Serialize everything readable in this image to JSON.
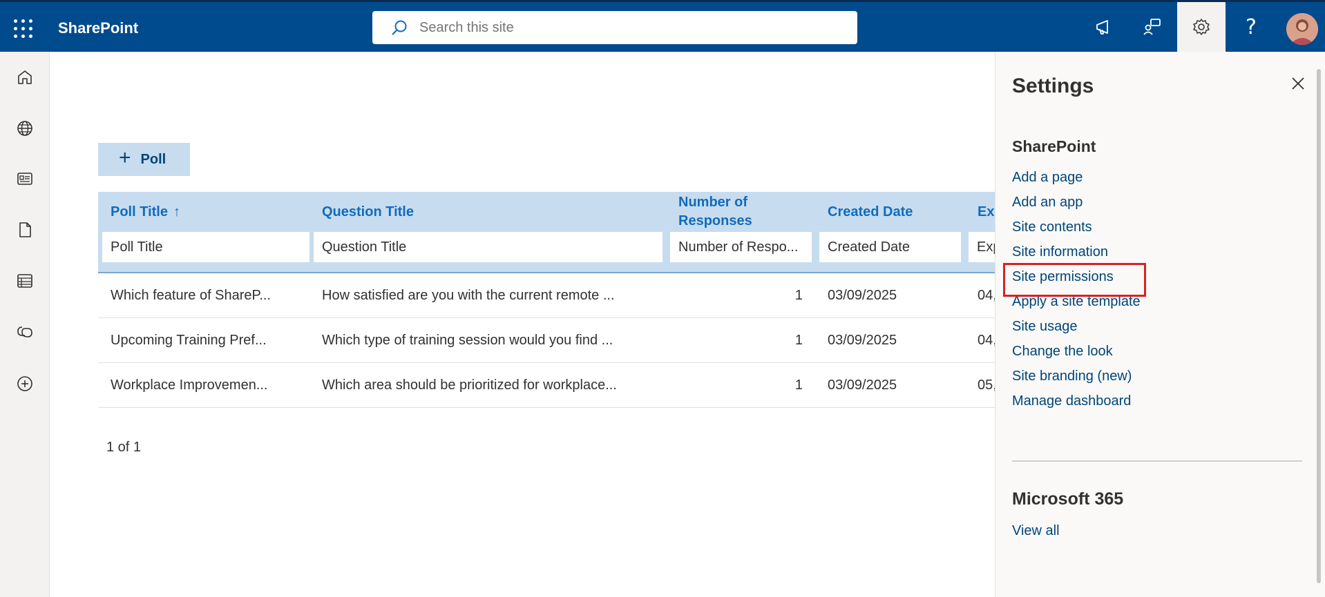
{
  "app": {
    "brand": "SharePoint"
  },
  "search": {
    "placeholder": "Search this site"
  },
  "toolbar": {
    "poll_label": "Poll"
  },
  "table": {
    "headers": {
      "poll_title": "Poll Title",
      "sort_arrow": "↑",
      "question_title": "Question Title",
      "responses_line1": "Number of",
      "responses_line2": "Responses",
      "created_date": "Created Date",
      "expiry": "Exp"
    },
    "filters": {
      "poll_title": "Poll Title",
      "question_title": "Question Title",
      "responses": "Number of Respo...",
      "created_date": "Created Date",
      "expiry": "Exp"
    },
    "rows": [
      {
        "poll_title": "Which feature of ShareP...",
        "question": "How satisfied are you with the current remote ...",
        "responses": "1",
        "created": "03/09/2025",
        "expiry": "04,"
      },
      {
        "poll_title": "Upcoming Training Pref...",
        "question": "Which type of training session would you find ...",
        "responses": "1",
        "created": "03/09/2025",
        "expiry": "04,"
      },
      {
        "poll_title": "Workplace Improvemen...",
        "question": "Which area should be prioritized for workplace...",
        "responses": "1",
        "created": "03/09/2025",
        "expiry": "05,"
      }
    ],
    "pager": "1 of 1"
  },
  "settings": {
    "title": "Settings",
    "sharepoint_heading": "SharePoint",
    "links": [
      "Add a page",
      "Add an app",
      "Site contents",
      "Site information",
      "Site permissions",
      "Apply a site template",
      "Site usage",
      "Change the look",
      "Site branding (new)",
      "Manage dashboard"
    ],
    "highlighted_link": "Site permissions",
    "m365_heading": "Microsoft 365",
    "view_all": "View all"
  },
  "colors": {
    "suite_bar": "#004b8d",
    "header_bg": "#c7dcef",
    "link": "#004578",
    "highlight": "#d92121"
  }
}
